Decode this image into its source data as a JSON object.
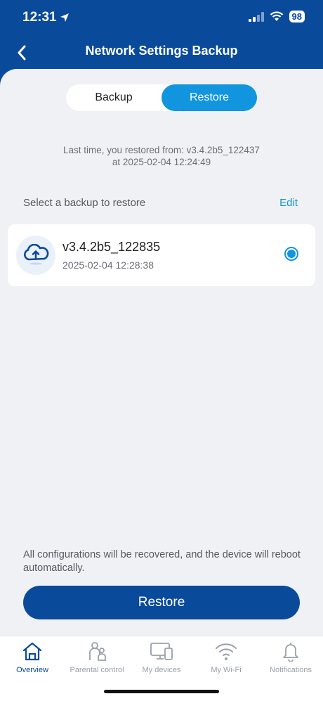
{
  "status": {
    "time": "12:31",
    "battery": "98"
  },
  "nav": {
    "title": "Network Settings Backup"
  },
  "segments": {
    "backup": "Backup",
    "restore": "Restore",
    "selected": "restore"
  },
  "last_restore": {
    "line1": "Last time, you restored from: v3.4.2b5_122437",
    "line2": "at 2025-02-04 12:24:49"
  },
  "list": {
    "label": "Select a backup to restore",
    "edit": "Edit"
  },
  "backups": [
    {
      "name": "v3.4.2b5_122835",
      "date": "2025-02-04 12:28:38",
      "selected": true
    }
  ],
  "footer": {
    "note": "All configurations will be recovered, and the device will reboot automatically.",
    "button": "Restore"
  },
  "tabs": [
    {
      "label": "Overview",
      "icon": "home-icon",
      "active": true
    },
    {
      "label": "Parental control",
      "icon": "parental-icon",
      "active": false
    },
    {
      "label": "My devices",
      "icon": "devices-icon",
      "active": false
    },
    {
      "label": "My Wi-Fi",
      "icon": "wifi-icon",
      "active": false
    },
    {
      "label": "Notifications",
      "icon": "bell-icon",
      "active": false
    }
  ],
  "colors": {
    "brand": "#0a4a9b",
    "accent": "#1195df",
    "background": "#eff1f5"
  }
}
